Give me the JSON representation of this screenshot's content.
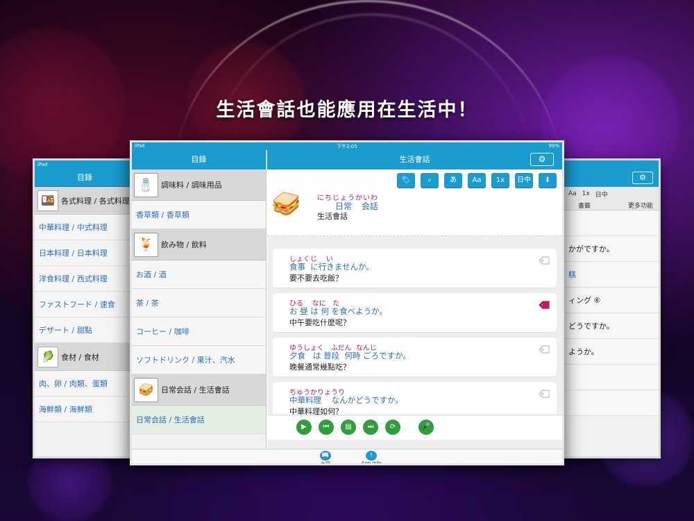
{
  "headline": "生活會話也能應用在生活中！",
  "colors": {
    "accent": "#1a9ccf",
    "play_green": "#2e9e3a",
    "furigana": "#c2185b",
    "link_blue": "#2a6fbe"
  },
  "back_left": {
    "status": "iPad",
    "header": "目錄",
    "rows": [
      {
        "type": "cat",
        "label": "各式料理 / 各式料理",
        "icon": "bento-icon"
      },
      {
        "type": "item",
        "label": "中華料理 / 中式料理"
      },
      {
        "type": "item",
        "label": "日本料理 / 日本料理"
      },
      {
        "type": "item",
        "label": "洋食料理 / 西式料理"
      },
      {
        "type": "item",
        "label": "ファストフード / 速食"
      },
      {
        "type": "item",
        "label": "デザート / 甜點"
      },
      {
        "type": "cat",
        "label": "食材 / 食材",
        "icon": "vegetables-icon"
      },
      {
        "type": "item",
        "label": "肉、卵 / 肉類、蛋類"
      },
      {
        "type": "item",
        "label": "海鮮類 / 海鮮類"
      }
    ]
  },
  "back_right": {
    "tools": [
      "Aa",
      "1x",
      "日中"
    ],
    "tab_left": "書籤",
    "tab_right": "更多功能",
    "rows": [
      "",
      "かがですか。",
      "糕",
      "ィング ⑥",
      "どうですか。",
      "ようか。",
      "",
      ""
    ]
  },
  "main": {
    "status_left": "iPad",
    "status_time": "下午2:05",
    "status_battery": "99%",
    "left_header": "目錄",
    "list": [
      {
        "type": "cat",
        "label": "調味料 / 調味用品",
        "icon": "condiment-icon"
      },
      {
        "type": "item",
        "label": "香草類 / 香草類"
      },
      {
        "type": "cat",
        "label": "飲み物 / 飲料",
        "icon": "drinks-icon"
      },
      {
        "type": "item",
        "label": "お酒 / 酒"
      },
      {
        "type": "item",
        "label": "茶 / 茶"
      },
      {
        "type": "item",
        "label": "コーヒー / 咖啡"
      },
      {
        "type": "item",
        "label": "ソフトドリンク / 果汁、汽水"
      },
      {
        "type": "cat",
        "label": "日常会話 / 生活會話",
        "icon": "sandwich-icon"
      },
      {
        "type": "item",
        "label": "日常会話 / 生活會話",
        "selected": true
      }
    ],
    "right_header": "生活會話",
    "settings_icon": "gear-icon",
    "toolbar": [
      {
        "name": "bookmark-tool",
        "label": "🏷"
      },
      {
        "name": "search-tool",
        "label": "⌕"
      },
      {
        "name": "kana-tool",
        "label": "あ"
      },
      {
        "name": "font-size-tool",
        "label": "Aa"
      },
      {
        "name": "speed-tool",
        "label": "1x"
      },
      {
        "name": "language-tool",
        "label": "日中"
      },
      {
        "name": "download-tool",
        "label": "⬇"
      }
    ],
    "title_card": {
      "furigana": "にちじょうかいわ",
      "japanese": "日常 会話",
      "chinese": "生活會話"
    },
    "phrases": [
      {
        "furigana": "しょくじ    い",
        "japanese": "食事  に行きませんか。",
        "chinese": "要不要去吃飯？",
        "tagged": false
      },
      {
        "furigana": "ひる    なに   た",
        "japanese": "お 昼 は 何 を食べようか。",
        "chinese": "中午要吃什麼呢？",
        "tagged": true
      },
      {
        "furigana": "ゆうしょく   ふだん  なんじ",
        "japanese": "夕食   は 普段  何時 ごろですか。",
        "chinese": "晚餐通常幾點吃？",
        "tagged": false
      },
      {
        "furigana": "ちゅうかりょうり",
        "japanese": "中華料理    なんかどうですか。",
        "chinese": "中華料理如何？",
        "tagged": false
      }
    ],
    "player": [
      {
        "name": "play-button",
        "icon": "play-icon",
        "glyph": "▶"
      },
      {
        "name": "previous-button",
        "icon": "skip-back-icon",
        "glyph": "⏮"
      },
      {
        "name": "list-button",
        "icon": "document-icon",
        "glyph": "▤"
      },
      {
        "name": "next-button",
        "icon": "skip-forward-icon",
        "glyph": "⏭"
      },
      {
        "name": "repeat-button",
        "icon": "repeat-icon",
        "glyph": "⟳"
      },
      {
        "name": "record-button",
        "icon": "microphone-icon",
        "glyph": "🎤"
      }
    ],
    "tabs": [
      {
        "label": "內容",
        "icon": "book-icon",
        "glyph": "📖"
      },
      {
        "label": "App Info",
        "icon": "info-icon",
        "glyph": "!"
      }
    ]
  }
}
